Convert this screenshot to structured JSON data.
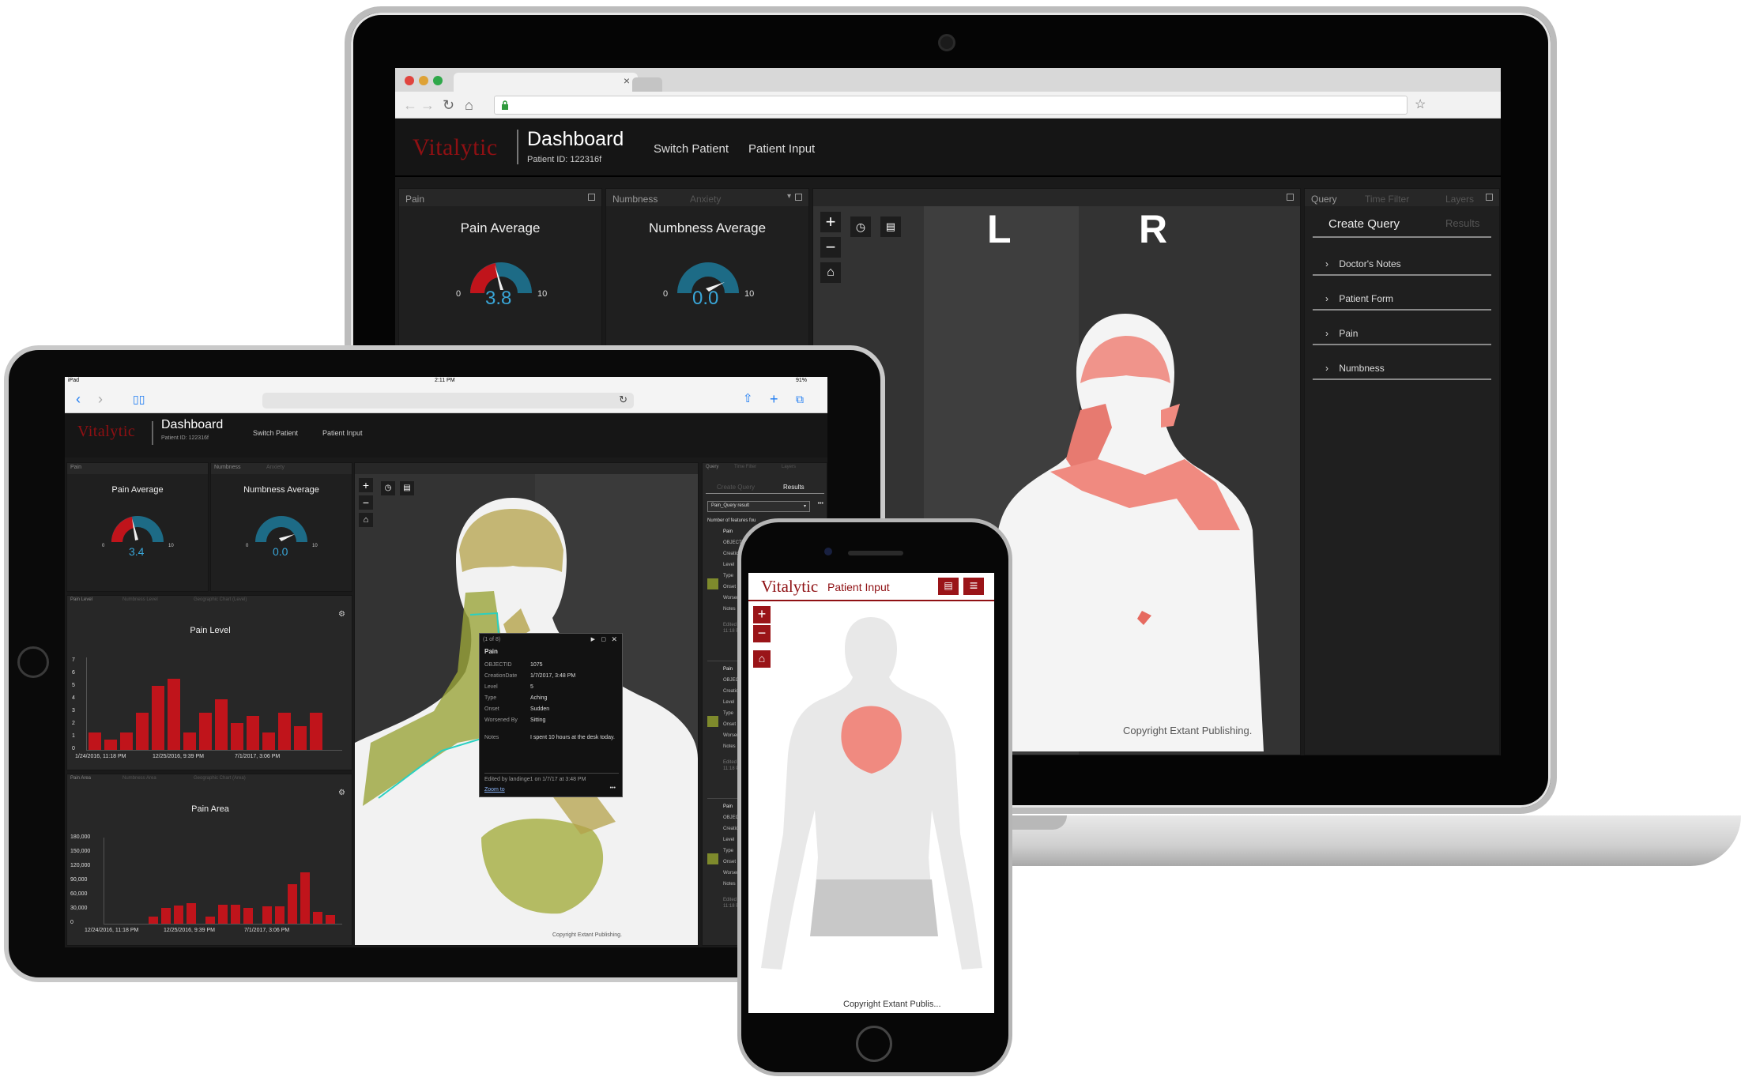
{
  "laptop": {
    "browser": {
      "tab_close": "×"
    },
    "app": {
      "brand": "Vitalytic",
      "title": "Dashboard",
      "patient_id": "Patient ID: 122316f",
      "nav": [
        "Switch Patient",
        "Patient Input"
      ]
    },
    "pain_panel": {
      "tab": "Pain",
      "title": "Pain Average",
      "min": "0",
      "max": "10",
      "value": "3.8"
    },
    "numbness_panel": {
      "tabs": [
        "Numbness",
        "Anxiety"
      ],
      "title": "Numbness Average",
      "min": "0",
      "max": "10",
      "value": "0.0"
    },
    "body_map": {
      "left_label": "L",
      "right_label": "R",
      "copyright": "Copyright Extant Publishing."
    },
    "query_panel": {
      "tabs": [
        "Query",
        "Time Filter",
        "Layers"
      ],
      "subtabs": [
        "Create Query",
        "Results"
      ],
      "items": [
        "Doctor's Notes",
        "Patient Form",
        "Pain",
        "Numbness"
      ]
    }
  },
  "tablet": {
    "status": {
      "left": "iPad",
      "time": "2:11 PM",
      "battery": "91%"
    },
    "app": {
      "brand": "Vitalytic",
      "title": "Dashboard",
      "patient_id": "Patient ID: 122316f",
      "nav": [
        "Switch Patient",
        "Patient Input"
      ]
    },
    "pain_panel": {
      "tab": "Pain",
      "title": "Pain Average",
      "min": "0",
      "max": "10",
      "value": "3.4"
    },
    "numbness_panel": {
      "tabs": [
        "Numbness",
        "Anxiety"
      ],
      "title": "Numbness Average",
      "min": "0",
      "max": "10",
      "value": "0.0"
    },
    "pain_level_chart": {
      "tabs": [
        "Pain Level",
        "Numbness Level",
        "Geographic Chart (Level)"
      ],
      "title": "Pain Level",
      "y_ticks": [
        "7",
        "6",
        "5",
        "4",
        "3",
        "2",
        "1",
        "0"
      ],
      "x_labels": [
        "1/24/2016, 11:18 PM",
        "12/25/2016, 9:39 PM",
        "7/1/2017, 3:06 PM"
      ]
    },
    "pain_area_chart": {
      "tabs": [
        "Pain Area",
        "Numbness Area",
        "Geographic Chart (Area)"
      ],
      "title": "Pain Area",
      "y_ticks": [
        "180,000",
        "150,000",
        "120,000",
        "90,000",
        "60,000",
        "30,000",
        "0"
      ],
      "x_labels": [
        "12/24/2016, 11:18 PM",
        "12/25/2016, 9:39 PM",
        "7/1/2017, 3:06 PM"
      ]
    },
    "popup": {
      "counter": "(1 of 8)",
      "title": "Pain",
      "rows": [
        {
          "k": "OBJECTID",
          "v": "1075"
        },
        {
          "k": "CreationDate",
          "v": "1/7/2017, 3:48 PM"
        },
        {
          "k": "Level",
          "v": "5"
        },
        {
          "k": "Type",
          "v": "Aching"
        },
        {
          "k": "Onset",
          "v": "Sudden"
        },
        {
          "k": "Worsened By",
          "v": "Sitting"
        },
        {
          "k": "Notes",
          "v": "I spent 10 hours at the desk today."
        }
      ],
      "footer": "Edited by landinge1 on 1/7/17 at 3:48 PM",
      "zoom": "Zoom to",
      "more": "•••"
    },
    "query_panel": {
      "tabs": [
        "Query",
        "Time Filter",
        "Layers"
      ],
      "subtabs": [
        "Create Query",
        "Results"
      ],
      "select": "Pain_Query result",
      "count_label": "Number of features fou",
      "result_title": "Pain",
      "fields": [
        "OBJECTID",
        "CreationDate",
        "Level",
        "Type",
        "Onset",
        "Worsened By",
        "Notes"
      ],
      "edited": "Edited by landi",
      "time": "11:18 PM"
    },
    "body_map": {
      "copyright": "Copyright Extant Publishing."
    }
  },
  "phone": {
    "brand": "Vitalytic",
    "link": "Patient Input",
    "copyright": "Copyright Extant Publis..."
  },
  "colors": {
    "brand": "#8f1013",
    "bar": "#c0141b",
    "gauge_blue": "#39a6d8",
    "gauge_teal": "#1d6b86",
    "pain_overlay": "#f08a80",
    "olive_overlay": "#b4a24a"
  },
  "icons": [
    "plus-icon",
    "minus-icon",
    "home-icon",
    "history-icon",
    "note-icon",
    "menu-icon",
    "close-icon",
    "chevron-right-icon",
    "share-icon",
    "tabs-icon",
    "book-icon",
    "lock-icon",
    "star-icon",
    "refresh-icon"
  ]
}
